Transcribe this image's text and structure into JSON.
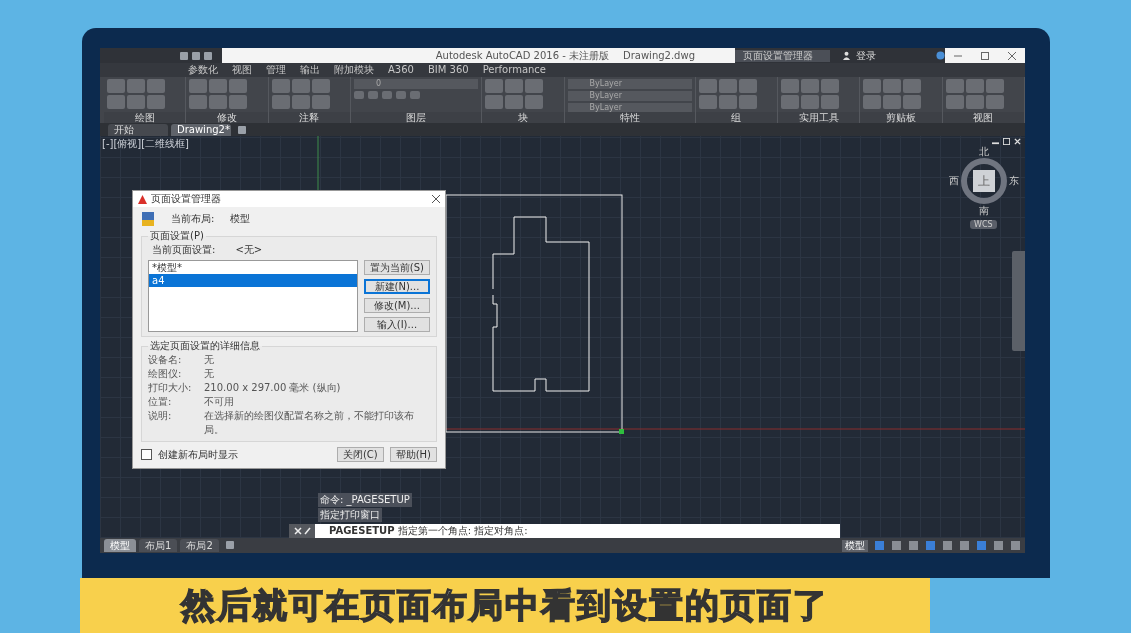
{
  "title_bar": {
    "title": "Autodesk AutoCAD 2016 - 未注册版",
    "file": "Drawing2.dwg",
    "search": "页面设置管理器",
    "sign_in": "登录"
  },
  "ribbon_tabs": [
    {
      "label": "参数化"
    },
    {
      "label": "视图"
    },
    {
      "label": "管理"
    },
    {
      "label": "输出"
    },
    {
      "label": "附加模块"
    },
    {
      "label": "A360"
    },
    {
      "label": "BIM 360"
    },
    {
      "label": "Performance"
    }
  ],
  "ribbon_panels": [
    {
      "label": "绘图",
      "kind": "tools"
    },
    {
      "label": "修改",
      "kind": "tools"
    },
    {
      "label": "注释",
      "kind": "tools"
    },
    {
      "label": "图层",
      "kind": "layers",
      "field": "0"
    },
    {
      "label": "块",
      "kind": "tools"
    },
    {
      "label": "特性",
      "kind": "properties",
      "fields": [
        "ByLayer",
        "ByLayer",
        "ByLayer"
      ]
    },
    {
      "label": "组",
      "kind": "tools"
    },
    {
      "label": "实用工具",
      "kind": "tools"
    },
    {
      "label": "剪贴板",
      "kind": "tools"
    },
    {
      "label": "视图",
      "kind": "tools"
    }
  ],
  "file_tabs": [
    {
      "label": "开始",
      "selected": false
    },
    {
      "label": "Drawing2*",
      "selected": true
    }
  ],
  "viewport_label": "[-][俯视][二维线框]",
  "viewcube": {
    "north": "北",
    "south": "南",
    "west": "西",
    "east": "东",
    "face": "上",
    "wcs": "WCS"
  },
  "dialog": {
    "title": "页面设置管理器",
    "layout_label": "当前布局:",
    "layout_value": "模型",
    "group_title": "页面设置(P)",
    "current_label": "当前页面设置:",
    "current_value": "<无>",
    "list": [
      {
        "label": "*模型*",
        "selected": false
      },
      {
        "label": "a4",
        "selected": true
      }
    ],
    "buttons": [
      {
        "label": "置为当前(S)",
        "focused": false
      },
      {
        "label": "新建(N)...",
        "focused": true
      },
      {
        "label": "修改(M)...",
        "focused": false
      },
      {
        "label": "输入(I)...",
        "focused": false
      }
    ],
    "details_title": "选定页面设置的详细信息",
    "details": [
      {
        "label": "设备名:",
        "value": "无"
      },
      {
        "label": "绘图仪:",
        "value": "无"
      },
      {
        "label": "打印大小:",
        "value": "210.00 x 297.00 毫米 (纵向)"
      },
      {
        "label": "位置:",
        "value": "不可用"
      },
      {
        "label": "说明:",
        "value": "在选择新的绘图仪配置名称之前，不能打印该布局。"
      }
    ],
    "show_on_create": {
      "label": "创建新布局时显示",
      "checked": false
    },
    "footer_buttons": [
      "关闭(C)",
      "帮助(H)"
    ]
  },
  "command_history": [
    "命令: _PAGESETUP",
    "指定打印窗口"
  ],
  "command_line": {
    "command": "PAGESETUP",
    "prompt": "指定第一个角点: 指定对角点:"
  },
  "layout_tabs": [
    {
      "label": "模型",
      "selected": true
    },
    {
      "label": "布局1",
      "selected": false
    },
    {
      "label": "布局2",
      "selected": false
    }
  ],
  "status_bar": {
    "space": "模型"
  },
  "subtitle": "然后就可在页面布局中看到设置的页面了"
}
